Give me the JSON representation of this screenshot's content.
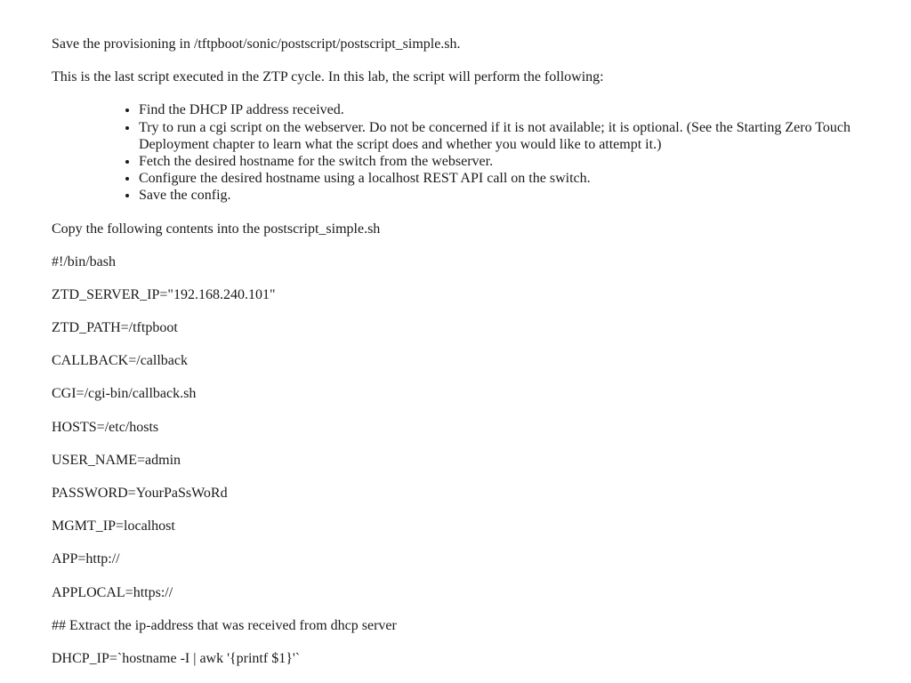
{
  "intro": {
    "line1": "Save the provisioning in /tftpboot/sonic/postscript/postscript_simple.sh.",
    "line2": "This is the last script executed in the ZTP cycle. In this lab, the script will perform the following:"
  },
  "bullets": [
    "Find the DHCP IP address received.",
    "Try to run a cgi script on the webserver. Do not be concerned if it is not available; it is optional. (See the Starting Zero Touch Deployment chapter to learn what the script does and whether you would like to attempt it.)",
    "Fetch the desired hostname for the switch from the webserver.",
    "Configure the desired hostname using a localhost REST API call on the switch.",
    "Save the config."
  ],
  "copy_instruction": "Copy the following contents into the postscript_simple.sh",
  "script": {
    "l1": "#!/bin/bash",
    "l2": "ZTD_SERVER_IP=\"192.168.240.101\"",
    "l3": "ZTD_PATH=/tftpboot",
    "l4": "CALLBACK=/callback",
    "l5": "CGI=/cgi-bin/callback.sh",
    "l6": "HOSTS=/etc/hosts",
    "l7": "USER_NAME=admin",
    "l8": "PASSWORD=YourPaSsWoRd",
    "l9": "MGMT_IP=localhost",
    "l10": "APP=http://",
    "l11": "APPLOCAL=https://",
    "l12": "## Extract the ip-address that was received from dhcp server",
    "l13": "DHCP_IP=`hostname -I | awk '{printf $1}'`"
  }
}
